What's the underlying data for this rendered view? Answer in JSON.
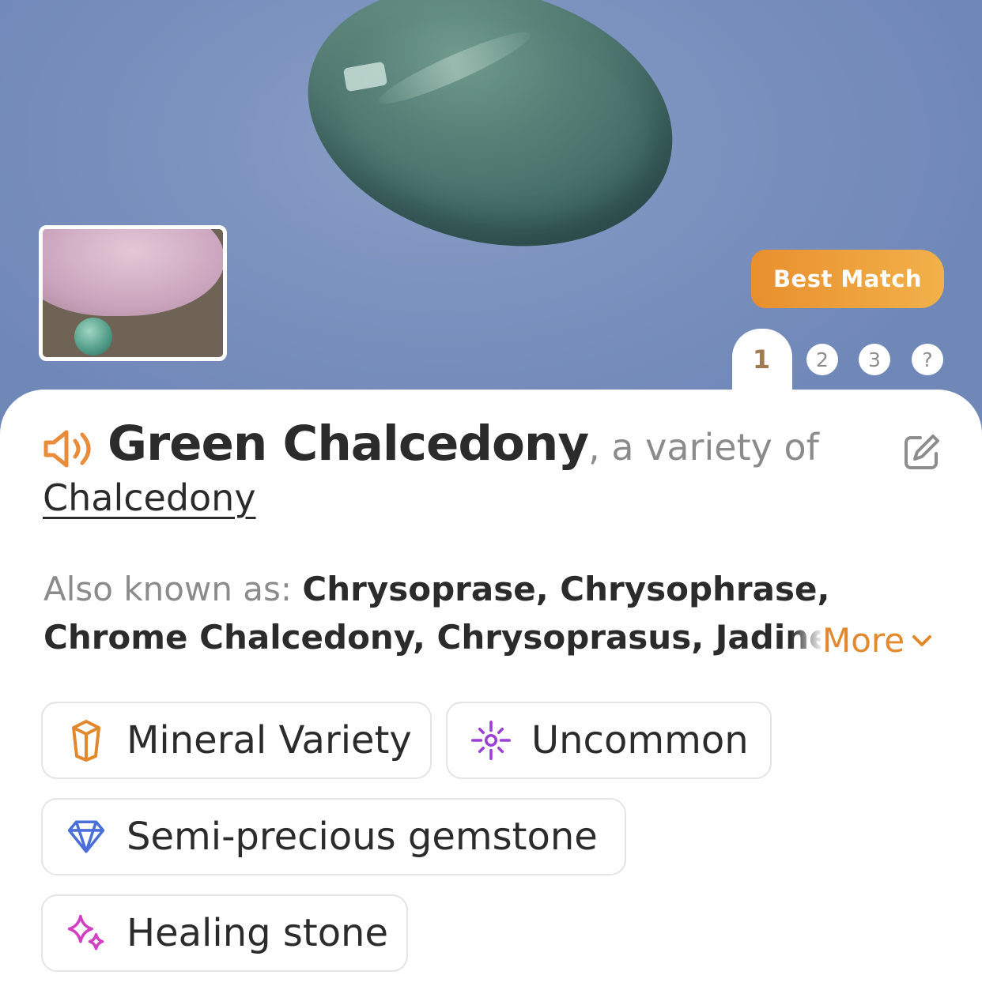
{
  "hero": {
    "badge_label": "Best Match",
    "pagination": [
      "1",
      "2",
      "3",
      "?"
    ]
  },
  "result": {
    "name": "Green Chalcedony",
    "variety_text": ", a variety of",
    "parent": "Chalcedony",
    "aka_label": "Also known as: ",
    "aka_line1": "Chrysoprase, Chrysophrase,",
    "aka_line2": "Chrome Chalcedony, Chrysoprasus, Jadine",
    "more_label": "More"
  },
  "chips": [
    {
      "label": "Mineral Variety",
      "icon": "crystal-icon",
      "color": "#e2882c"
    },
    {
      "label": "Uncommon",
      "icon": "sparkle-burst-icon",
      "color": "#9b3fd6"
    },
    {
      "label": "Semi-precious gemstone",
      "icon": "diamond-icon",
      "color": "#4a6fd8"
    },
    {
      "label": "Healing stone",
      "icon": "sparkles-icon",
      "color": "#d23fc2"
    }
  ],
  "colors": {
    "accent": "#e3892d",
    "text": "#2b2b2b",
    "muted": "#8b8b8b"
  }
}
